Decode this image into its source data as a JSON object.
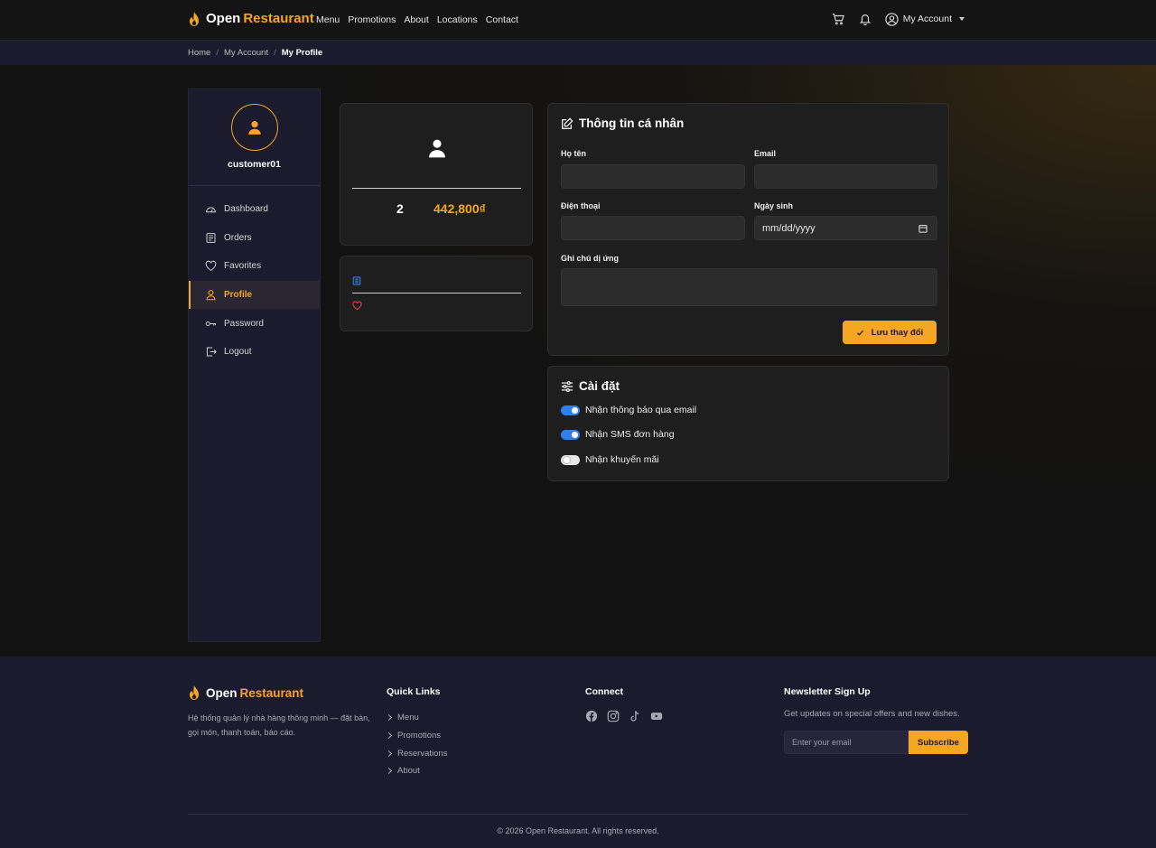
{
  "brand": {
    "name_part1": "Open",
    "name_part2": "Restaurant",
    "accent": "#f5a623"
  },
  "nav": {
    "links": [
      "Menu",
      "Promotions",
      "About",
      "Locations",
      "Contact"
    ],
    "cart_icon": "cart-icon",
    "bell_icon": "bell-icon",
    "account_label": "My Account"
  },
  "breadcrumb": {
    "items": [
      "Home",
      "My Account"
    ],
    "current": "My Profile"
  },
  "sidebar": {
    "username": "customer01",
    "items": [
      {
        "label": "Dashboard",
        "icon": "speedometer-icon"
      },
      {
        "label": "Orders",
        "icon": "receipt-icon"
      },
      {
        "label": "Favorites",
        "icon": "heart-icon"
      },
      {
        "label": "Profile",
        "icon": "person-icon",
        "active": true
      },
      {
        "label": "Password",
        "icon": "key-icon"
      },
      {
        "label": "Logout",
        "icon": "logout-icon"
      }
    ]
  },
  "stats": {
    "orders_count": "2",
    "total_spent": "442,800₫"
  },
  "profile_form": {
    "title": "Thông tin cá nhân",
    "fullname_label": "Họ tên",
    "fullname_value": "",
    "email_label": "Email",
    "email_value": "",
    "phone_label": "Điện thoại",
    "phone_value": "",
    "birthday_label": "Ngày sinh",
    "birthday_placeholder": "mm/dd/yyyy",
    "allergy_label": "Ghi chú dị ứng",
    "allergy_value": "",
    "save_label": "Lưu thay đổi"
  },
  "settings": {
    "title": "Cài đặt",
    "toggles": [
      {
        "label": "Nhận thông báo qua email",
        "on": true
      },
      {
        "label": "Nhận SMS đơn hàng",
        "on": true
      },
      {
        "label": "Nhận khuyến mãi",
        "on": false
      }
    ]
  },
  "footer": {
    "description": "Hệ thống quản lý nhà hàng thông minh — đặt bàn, gọi món, thanh toán, báo cáo.",
    "quick_links_title": "Quick Links",
    "quick_links": [
      "Menu",
      "Promotions",
      "Reservations",
      "About"
    ],
    "connect_title": "Connect",
    "socials": [
      "facebook-icon",
      "instagram-icon",
      "tiktok-icon",
      "youtube-icon"
    ],
    "newsletter_title": "Newsletter Sign Up",
    "newsletter_desc": "Get updates on special offers and new dishes.",
    "newsletter_placeholder": "Enter your email",
    "subscribe_label": "Subscribe",
    "copyright": "© 2026 Open Restaurant. All rights reserved."
  }
}
